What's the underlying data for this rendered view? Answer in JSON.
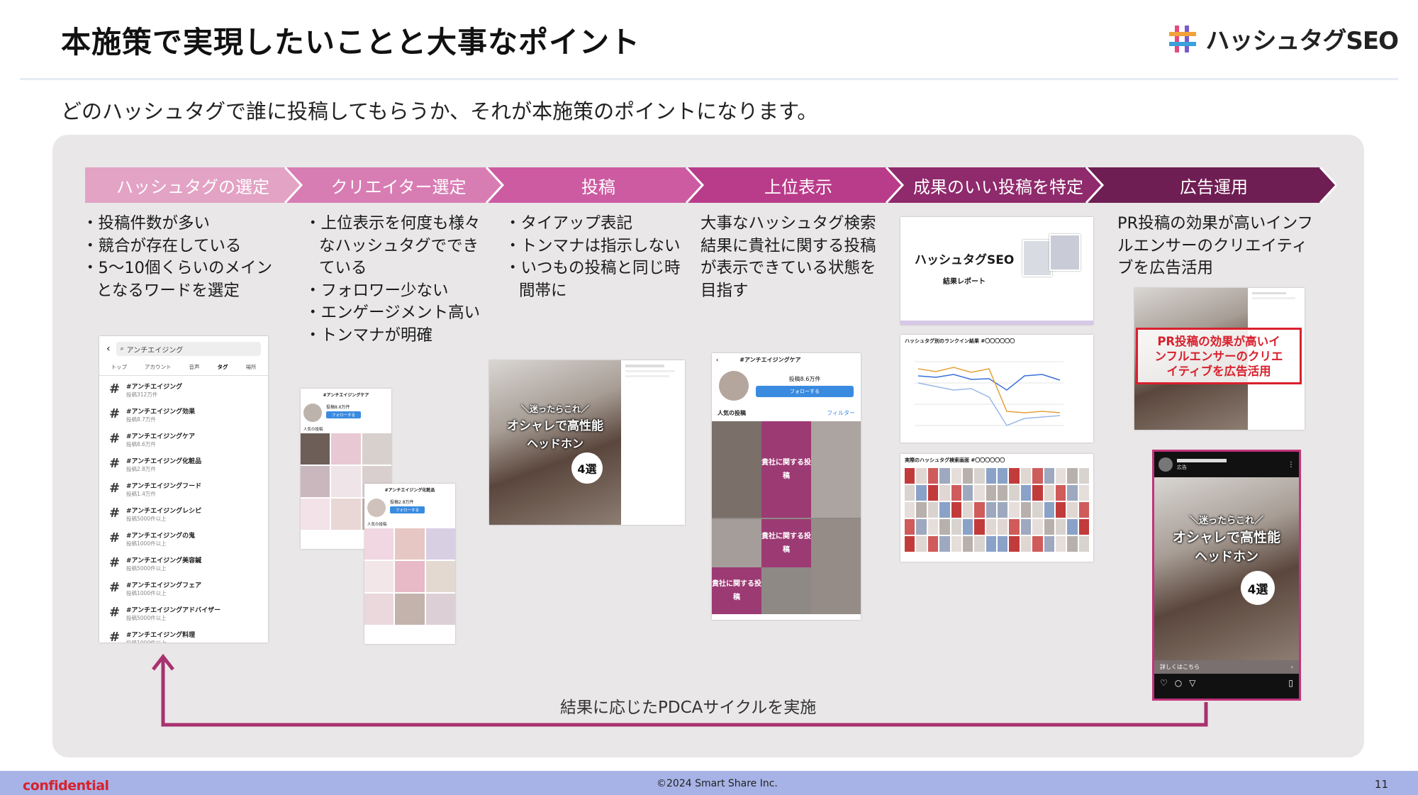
{
  "title": "本施策で実現したいことと大事なポイント",
  "logo": {
    "text": "ハッシュタグSEO",
    "icon": "hashtag-logo-icon"
  },
  "subtitle": "どのハッシュタグで誰に投稿してもらうか、それが本施策のポイントになります。",
  "steps": [
    {
      "label": "ハッシュタグの選定",
      "color": "#e3a3c5"
    },
    {
      "label": "クリエイター選定",
      "color": "#d87db4"
    },
    {
      "label": "投稿",
      "color": "#cc5ba2"
    },
    {
      "label": "上位表示",
      "color": "#b93c8a"
    },
    {
      "label": "成果のいい投稿を特定",
      "color": "#8f2a6c"
    },
    {
      "label": "広告運用",
      "color": "#6e1e53"
    }
  ],
  "col1": {
    "bullets": [
      "投稿件数が多い",
      "競合が存在している",
      "5〜10個くらいのメインとなるワードを選定"
    ]
  },
  "col2": {
    "bullets": [
      "上位表示を何度も様々なハッシュタグでできている",
      "フォロワー少ない",
      "エンゲージメント高い",
      "トンマナが明確"
    ]
  },
  "col3": {
    "bullets": [
      "タイアップ表記",
      "トンマナは指示しない",
      "いつもの投稿と同じ時間帯に"
    ]
  },
  "col4": {
    "text": "大事なハッシュタグ検索結果に貴社に関する投稿が表示できている状態を目指す"
  },
  "col6": {
    "text": "PR投稿の効果が高いインフルエンサーのクリエイティブを広告活用"
  },
  "search_ui": {
    "query": "アンチエイジング",
    "tabs": [
      "トップ",
      "アカウント",
      "音声",
      "タグ",
      "場所"
    ],
    "tags": [
      {
        "name": "#アンチエイジング",
        "count": "投稿312万件"
      },
      {
        "name": "#アンチエイジング効果",
        "count": "投稿8.7万件"
      },
      {
        "name": "#アンチエイジングケア",
        "count": "投稿8.6万件"
      },
      {
        "name": "#アンチエイジング化粧品",
        "count": "投稿2.8万件"
      },
      {
        "name": "#アンチエイジングフード",
        "count": "投稿1.4万件"
      },
      {
        "name": "#アンチエイジングレシピ",
        "count": "投稿5000件以上"
      },
      {
        "name": "#アンチエイジングの鬼",
        "count": "投稿1000件以上"
      },
      {
        "name": "#アンチエイジング美容鍼",
        "count": "投稿5000件以上"
      },
      {
        "name": "#アンチエイジングフェア",
        "count": "投稿1000件以上"
      },
      {
        "name": "#アンチエイジングアドバイザー",
        "count": "投稿5000件以上"
      },
      {
        "name": "#アンチエイジング料理",
        "count": "投稿1000件以上"
      }
    ]
  },
  "tag_page_a": {
    "title": "#アンチエイジングケア",
    "posts": "投稿8.6万件",
    "follow": "フォローする",
    "popular": "人気の投稿"
  },
  "tag_page_b": {
    "title": "#アンチエイジング化粧品",
    "posts": "投稿2.8万件",
    "follow": "フォローする",
    "popular": "人気の投稿"
  },
  "post_overlay": {
    "line1": "＼迷ったらこれ／",
    "line2": "オシャレで高性能",
    "line3": "ヘッドホン",
    "badge": "4選"
  },
  "tag_result": {
    "title": "#アンチエイジングケア",
    "posts": "投稿8.6万件",
    "follow": "フォローする",
    "popular": "人気の投稿",
    "filter": "フィルター",
    "block": "貴社に関する投稿"
  },
  "report": {
    "title": "ハッシュタグSEO",
    "sub": "結果レポート",
    "chart_title": "ハッシュタグ別のランクイン結果 #〇〇〇〇〇〇",
    "grid_title": "実際のハッシュタグ検索画面 #〇〇〇〇〇〇"
  },
  "ad_callout": "PR投稿の効果が高いインフルエンサーのクリエイティブを広告活用",
  "ad": {
    "sponsored": "広告",
    "cta": "詳しくはこちら"
  },
  "pdca": "結果に応じたPDCAサイクルを実施",
  "footer": {
    "confidential": "confidential",
    "copyright": "©2024 Smart Share Inc.",
    "page": "11"
  },
  "colors": {
    "accent": "#a8326e",
    "panel": "#e9e7e8",
    "footer": "#a7b3e6",
    "red": "#d8212d"
  }
}
